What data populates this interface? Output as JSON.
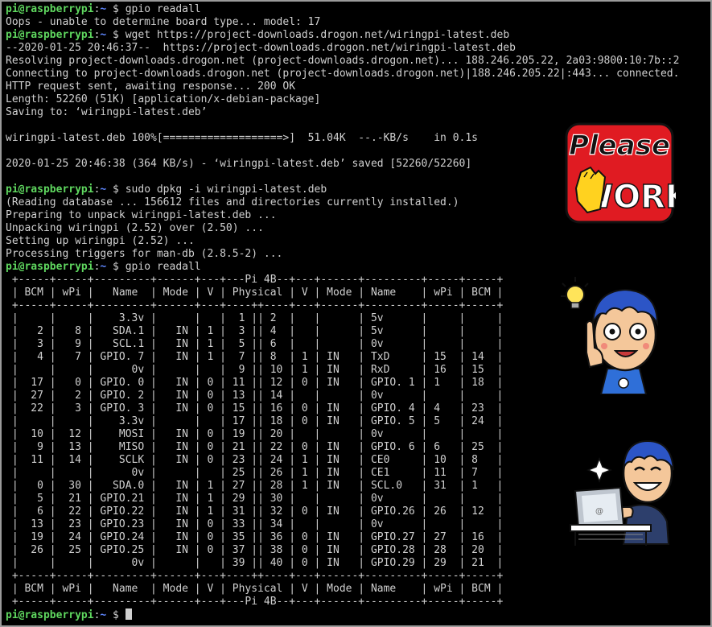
{
  "prompt": {
    "user_host": "pi@raspberrypi",
    "path": "~",
    "symbol": " $ "
  },
  "commands": [
    "gpio readall",
    "wget https://project-downloads.drogon.net/wiringpi-latest.deb",
    "sudo dpkg -i wiringpi-latest.deb",
    "gpio readall",
    ""
  ],
  "output": {
    "gpio_error": "Oops - unable to determine board type... model: 17",
    "wget": [
      "--2020-01-25 20:46:37--  https://project-downloads.drogon.net/wiringpi-latest.deb",
      "Resolving project-downloads.drogon.net (project-downloads.drogon.net)... 188.246.205.22, 2a03:9800:10:7b::2",
      "Connecting to project-downloads.drogon.net (project-downloads.drogon.net)|188.246.205.22|:443... connected.",
      "HTTP request sent, awaiting response... 200 OK",
      "Length: 52260 (51K) [application/x-debian-package]",
      "Saving to: ‘wiringpi-latest.deb’",
      "",
      "wiringpi-latest.deb 100%[===================>]  51.04K  --.-KB/s    in 0.1s",
      "",
      "2020-01-25 20:46:38 (364 KB/s) - ‘wiringpi-latest.deb’ saved [52260/52260]",
      ""
    ],
    "dpkg": [
      "(Reading database ... 156612 files and directories currently installed.)",
      "Preparing to unpack wiringpi-latest.deb ...",
      "Unpacking wiringpi (2.52) over (2.50) ...",
      "Setting up wiringpi (2.52) ...",
      "Processing triggers for man-db (2.8.5-2) ..."
    ],
    "readall_table": [
      " +-----+-----+---------+------+---+---Pi 4B--+---+------+---------+-----+-----+",
      " | BCM | wPi |   Name  | Mode | V | Physical | V | Mode | Name    | wPi | BCM |",
      " +-----+-----+---------+------+---+----++----+---+------+---------+-----+-----+",
      " |     |     |    3.3v |      |   |  1 || 2  |   |      | 5v      |     |     |",
      " |   2 |   8 |   SDA.1 |   IN | 1 |  3 || 4  |   |      | 5v      |     |     |",
      " |   3 |   9 |   SCL.1 |   IN | 1 |  5 || 6  |   |      | 0v      |     |     |",
      " |   4 |   7 | GPIO. 7 |   IN | 1 |  7 || 8  | 1 | IN   | TxD     | 15  | 14  |",
      " |     |     |      0v |      |   |  9 || 10 | 1 | IN   | RxD     | 16  | 15  |",
      " |  17 |   0 | GPIO. 0 |   IN | 0 | 11 || 12 | 0 | IN   | GPIO. 1 | 1   | 18  |",
      " |  27 |   2 | GPIO. 2 |   IN | 0 | 13 || 14 |   |      | 0v      |     |     |",
      " |  22 |   3 | GPIO. 3 |   IN | 0 | 15 || 16 | 0 | IN   | GPIO. 4 | 4   | 23  |",
      " |     |     |    3.3v |      |   | 17 || 18 | 0 | IN   | GPIO. 5 | 5   | 24  |",
      " |  10 |  12 |    MOSI |   IN | 0 | 19 || 20 |   |      | 0v      |     |     |",
      " |   9 |  13 |    MISO |   IN | 0 | 21 || 22 | 0 | IN   | GPIO. 6 | 6   | 25  |",
      " |  11 |  14 |    SCLK |   IN | 0 | 23 || 24 | 1 | IN   | CE0     | 10  | 8   |",
      " |     |     |      0v |      |   | 25 || 26 | 1 | IN   | CE1     | 11  | 7   |",
      " |   0 |  30 |   SDA.0 |   IN | 1 | 27 || 28 | 1 | IN   | SCL.0   | 31  | 1   |",
      " |   5 |  21 | GPIO.21 |   IN | 1 | 29 || 30 |   |      | 0v      |     |     |",
      " |   6 |  22 | GPIO.22 |   IN | 1 | 31 || 32 | 0 | IN   | GPIO.26 | 26  | 12  |",
      " |  13 |  23 | GPIO.23 |   IN | 0 | 33 || 34 |   |      | 0v      |     |     |",
      " |  19 |  24 | GPIO.24 |   IN | 0 | 35 || 36 | 0 | IN   | GPIO.27 | 27  | 16  |",
      " |  26 |  25 | GPIO.25 |   IN | 0 | 37 || 38 | 0 | IN   | GPIO.28 | 28  | 20  |",
      " |     |     |      0v |      |   | 39 || 40 | 0 | IN   | GPIO.29 | 29  | 21  |",
      " +-----+-----+---------+------+---+----++----+---+------+---------+-----+-----+",
      " | BCM | wPi |   Name  | Mode | V | Physical | V | Mode | Name    | wPi | BCM |",
      " +-----+-----+---------+------+---+---Pi 4B--+---+------+---------+-----+-----+"
    ]
  },
  "stickers": {
    "please_work": {
      "line1": "Please",
      "line2": "WORK"
    },
    "laptop_logo": "@"
  },
  "colors": {
    "background": "#000000",
    "text": "#d0d0d0",
    "prompt_user": "#5fd75f",
    "prompt_path": "#5f87ff",
    "sticker_red": "#e01b22",
    "sticker_yellow": "#ffd21f"
  }
}
